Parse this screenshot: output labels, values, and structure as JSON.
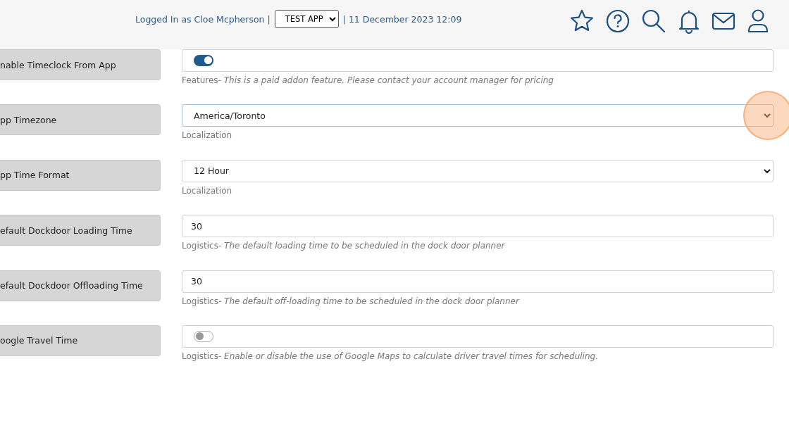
{
  "header": {
    "user_text": "Logged In as Cloe Mcpherson |",
    "app_select": "TEST APP",
    "date_text": "| 11 December 2023 12:09"
  },
  "settings": [
    {
      "label": "nable Timeclock From App",
      "kind": "toggle",
      "on": true,
      "category": "Features",
      "separator": "-",
      "description": "This is a paid addon feature. Please contact your account manager for pricing",
      "highlighted": false
    },
    {
      "label": "pp Timezone",
      "kind": "select",
      "value": "America/Toronto",
      "category": "Localization",
      "highlighted": true
    },
    {
      "label": "pp Time Format",
      "kind": "select",
      "value": "12 Hour",
      "category": "Localization",
      "highlighted": false
    },
    {
      "label": "efault Dockdoor Loading Time",
      "kind": "input",
      "value": "30",
      "category": "Logistics",
      "separator": "-",
      "description": "The default loading time to be scheduled in the dock door planner",
      "highlighted": false
    },
    {
      "label": "efault Dockdoor Offloading Time",
      "kind": "input",
      "value": "30",
      "category": "Logistics",
      "separator": "-",
      "description": "The default off-loading time to be scheduled in the dock door planner",
      "highlighted": false
    },
    {
      "label": "oogle Travel Time",
      "kind": "toggle",
      "on": false,
      "category": "Logistics",
      "separator": "-",
      "description": "Enable or disable the use of Google Maps to calculate driver travel times for scheduling.",
      "highlighted": false
    }
  ]
}
